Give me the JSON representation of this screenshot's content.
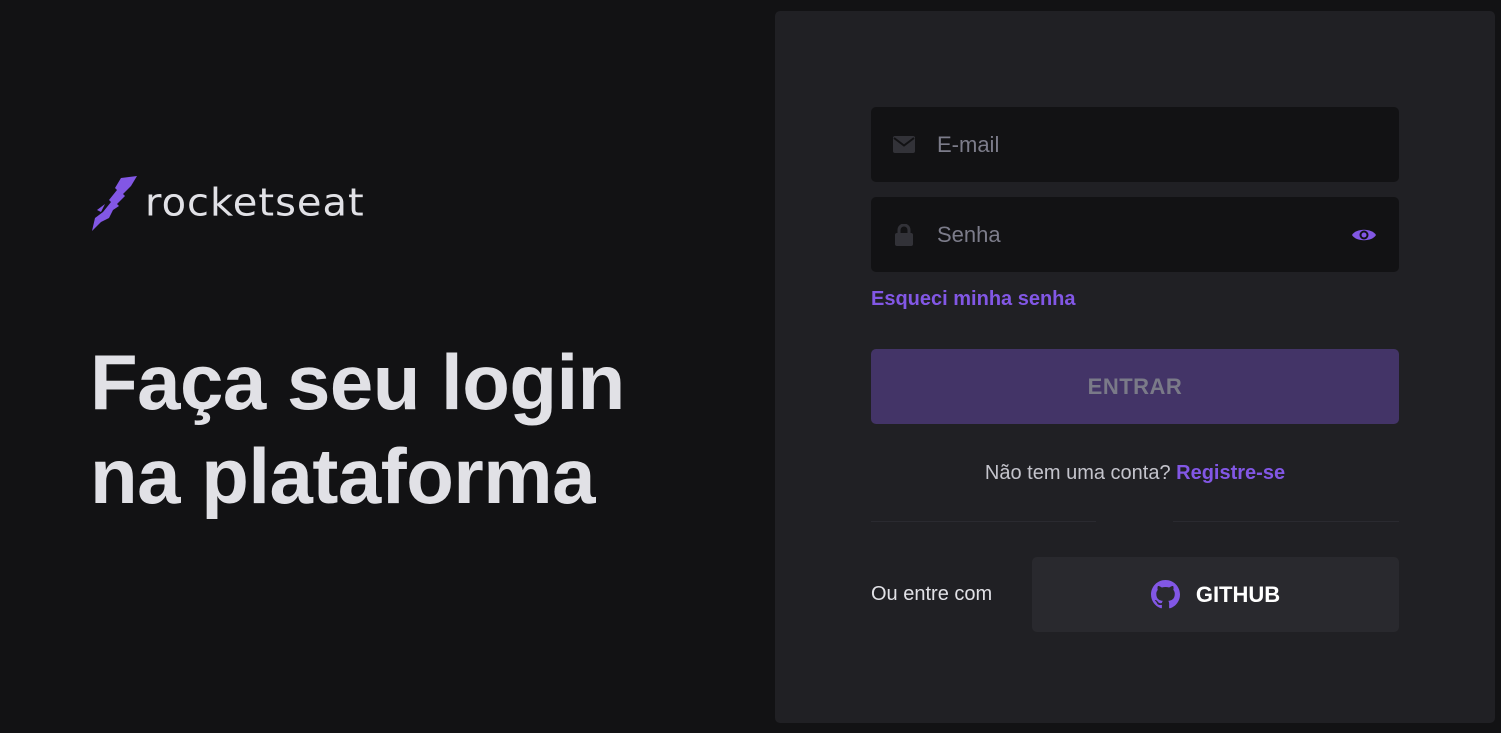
{
  "brand": {
    "name": "rocketseat",
    "accent_color": "#8257e5"
  },
  "hero": {
    "line1": "Faça seu login",
    "line2": "na plataforma"
  },
  "form": {
    "email_placeholder": "E-mail",
    "email_icon": "envelope-icon",
    "password_placeholder": "Senha",
    "password_icon": "lock-icon",
    "toggle_icon": "eye-icon",
    "forgot_label": "Esqueci minha senha",
    "submit_label": "ENTRAR",
    "signup_prompt": "Não tem uma conta?",
    "signup_link": "Registre-se"
  },
  "alt_login": {
    "label": "Ou entre com",
    "github_label": "GITHUB",
    "github_icon": "github-icon"
  }
}
